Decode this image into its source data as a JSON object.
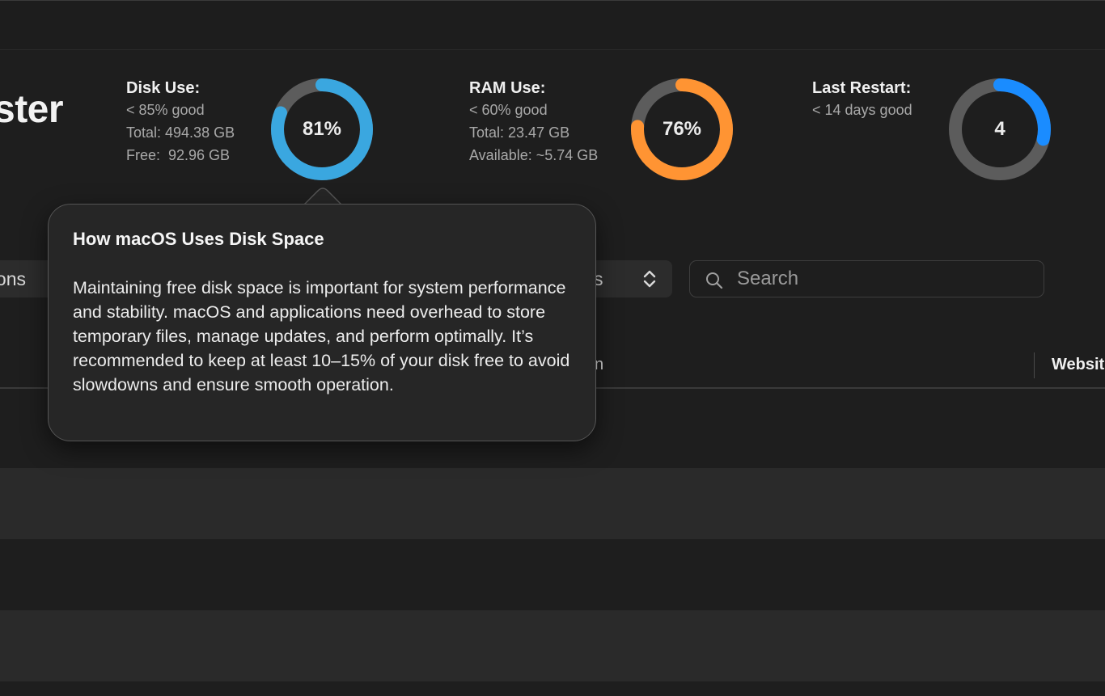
{
  "app": {
    "title_partial": "ster"
  },
  "stats": {
    "disk": {
      "title": "Disk Use:",
      "lines": [
        "< 85% good",
        "Total: 494.38 GB",
        "Free:  92.96 GB"
      ],
      "ring_label": "81%",
      "value": 0.81,
      "color": "#3aa7e0"
    },
    "ram": {
      "title": "RAM Use:",
      "lines": [
        "< 60% good",
        "Total: 23.47 GB",
        "Available: ~5.74 GB"
      ],
      "ring_label": "76%",
      "value": 0.76,
      "color": "#ff9433"
    },
    "restart": {
      "title": "Last Restart:",
      "lines": [
        "< 14 days good"
      ],
      "ring_label": "4",
      "value": 0.2857,
      "color": "#1a8cff"
    }
  },
  "filters": {
    "left_partial": "ons",
    "mid_partial": "s",
    "search_placeholder": "Search"
  },
  "table": {
    "col_partial": "n",
    "col_website": "Websit"
  },
  "popover": {
    "title": "How macOS Uses Disk Space",
    "body": "Maintaining free disk space is important for system performance and stability. macOS and applications need overhead to store temporary files, manage updates, and perform optimally. It’s recommended to keep at least 10–15% of your disk free to avoid slowdowns and ensure smooth operation."
  },
  "icons": {
    "search": "search-icon",
    "chevron": "chevron-up-down-icon"
  },
  "colors": {
    "ring_track": "#5c5c5c",
    "background": "#1e1e1e"
  }
}
